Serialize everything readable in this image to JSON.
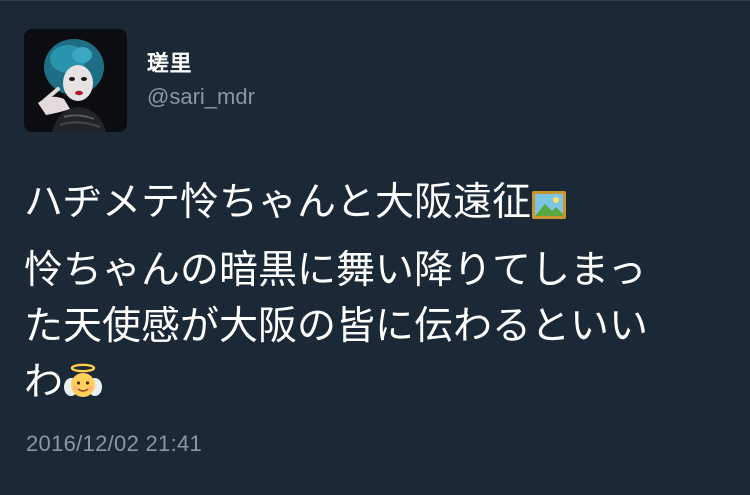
{
  "tweet": {
    "author": {
      "display_name": "瑳里",
      "handle": "@sari_mdr",
      "avatar": "profile-photo"
    },
    "text": {
      "line_1": "ハヂメテ怜ちゃんと大阪遠征",
      "line_1_emoji": "framed-picture-emoji",
      "line_2": "怜ちゃんの暗黒に舞い降りてしまっ",
      "line_3": "た天使感が大阪の皆に伝わるといい",
      "line_4": "わ",
      "line_4_emoji": "baby-angel-emoji"
    },
    "timestamp": "2016/12/02 21:41"
  },
  "colors": {
    "background": "#1b2836",
    "text": "#ffffff",
    "muted": "#8899a6"
  }
}
